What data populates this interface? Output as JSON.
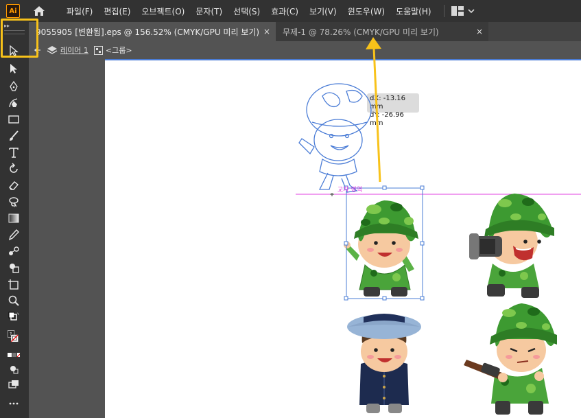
{
  "app": {
    "logo_text": "Ai",
    "accent_color": "#ff9a00",
    "highlight_color": "#f8c21a",
    "selection_color": "#4a7cd6",
    "guide_color": "#e040e0"
  },
  "menu": {
    "items": [
      "파일(F)",
      "편집(E)",
      "오브젝트(O)",
      "문자(T)",
      "선택(S)",
      "효과(C)",
      "보기(V)",
      "윈도우(W)",
      "도움말(H)"
    ]
  },
  "tabs": [
    {
      "label": "9055905 [변환됨].eps @ 156.52% (CMYK/GPU 미리 보기)",
      "close": "×",
      "active": true
    },
    {
      "label": "무제-1 @ 78.26% (CMYK/GPU 미리 보기)",
      "close": "×",
      "active": false
    }
  ],
  "breadcrumb": {
    "layer": "레이어 1",
    "group": "<그룹>"
  },
  "tooltip": {
    "dx": "dX: -13.16 mm",
    "dy": "dY: -26.96 mm"
  },
  "smart_guide": {
    "label": "교차 영역"
  },
  "tools": [
    "selection-tool",
    "direct-selection-tool",
    "pen-tool",
    "curvature-tool",
    "rectangle-tool",
    "paintbrush-tool",
    "type-tool",
    "rotate-tool",
    "eraser-tool",
    "lasso-tool",
    "gradient-tool",
    "eyedropper-tool",
    "blend-tool",
    "shape-builder-tool",
    "artboard-tool",
    "zoom-tool",
    "fill-stroke-swap",
    "fill-stroke-swatch",
    "color-mode",
    "draw-mode",
    "screen-mode",
    "more-tools"
  ],
  "fill_label": "?"
}
